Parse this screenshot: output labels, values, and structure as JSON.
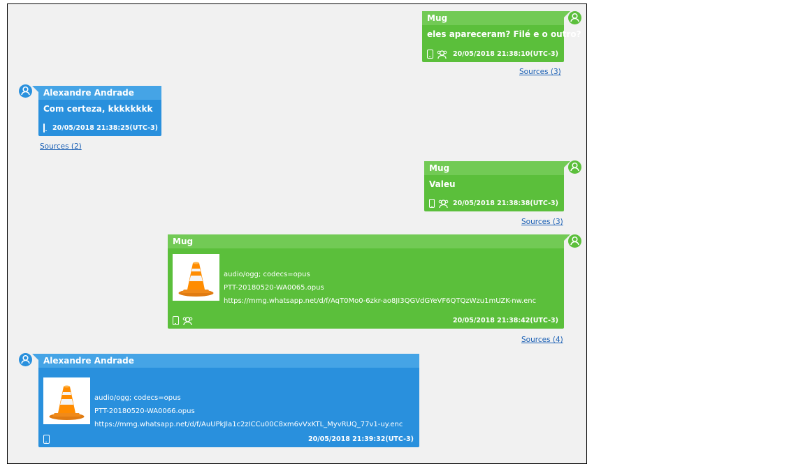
{
  "conversation": {
    "messages": [
      {
        "side": "right",
        "color": "green",
        "sender": "Mug",
        "text": "eles apareceram? Filé e o outro?",
        "timestamp": "20/05/2018 21:38:10(UTC-3)",
        "sources": "Sources (3)",
        "icons": [
          "phone-icon",
          "group-icon"
        ]
      },
      {
        "side": "left",
        "color": "blue",
        "sender": "Alexandre Andrade",
        "text": "Com certeza, kkkkkkkk",
        "timestamp": "20/05/2018 21:38:25(UTC-3)",
        "sources": "Sources (2)",
        "icons": [
          "phone-icon"
        ]
      },
      {
        "side": "right",
        "color": "green",
        "sender": "Mug",
        "text": "Valeu",
        "timestamp": "20/05/2018 21:38:38(UTC-3)",
        "sources": "Sources (3)",
        "icons": [
          "phone-icon",
          "group-icon"
        ]
      },
      {
        "side": "right",
        "color": "green",
        "sender": "Mug",
        "attachment": {
          "mime": "audio/ogg; codecs=opus",
          "filename": "PTT-20180520-WA0065.opus",
          "url": "https://mmg.whatsapp.net/d/f/AqT0Mo0-6zkr-ao8JI3QGVdGYeVF6QTQzWzu1mUZK-nw.enc",
          "thumbnail_icon": "vlc-cone-icon"
        },
        "timestamp": "20/05/2018 21:38:42(UTC-3)",
        "sources": "Sources (4)",
        "icons": [
          "phone-icon",
          "group-icon"
        ]
      },
      {
        "side": "left",
        "color": "blue",
        "sender": "Alexandre Andrade",
        "attachment": {
          "mime": "audio/ogg; codecs=opus",
          "filename": "PTT-20180520-WA0066.opus",
          "url": "https://mmg.whatsapp.net/d/f/AuUPkJla1c2zICCu00C8xm6vVxKTL_MyvRUQ_77v1-uy.enc",
          "thumbnail_icon": "vlc-cone-icon"
        },
        "timestamp": "20/05/2018 21:39:32(UTC-3)",
        "icons": [
          "phone-icon"
        ]
      }
    ]
  },
  "colors": {
    "outgoing_bubble": "#5bbf3b",
    "outgoing_header": "#72ca55",
    "incoming_bubble": "#2990dd",
    "incoming_header": "#45a4e6",
    "link": "#1a5fb4",
    "background": "#f1f1f1"
  }
}
